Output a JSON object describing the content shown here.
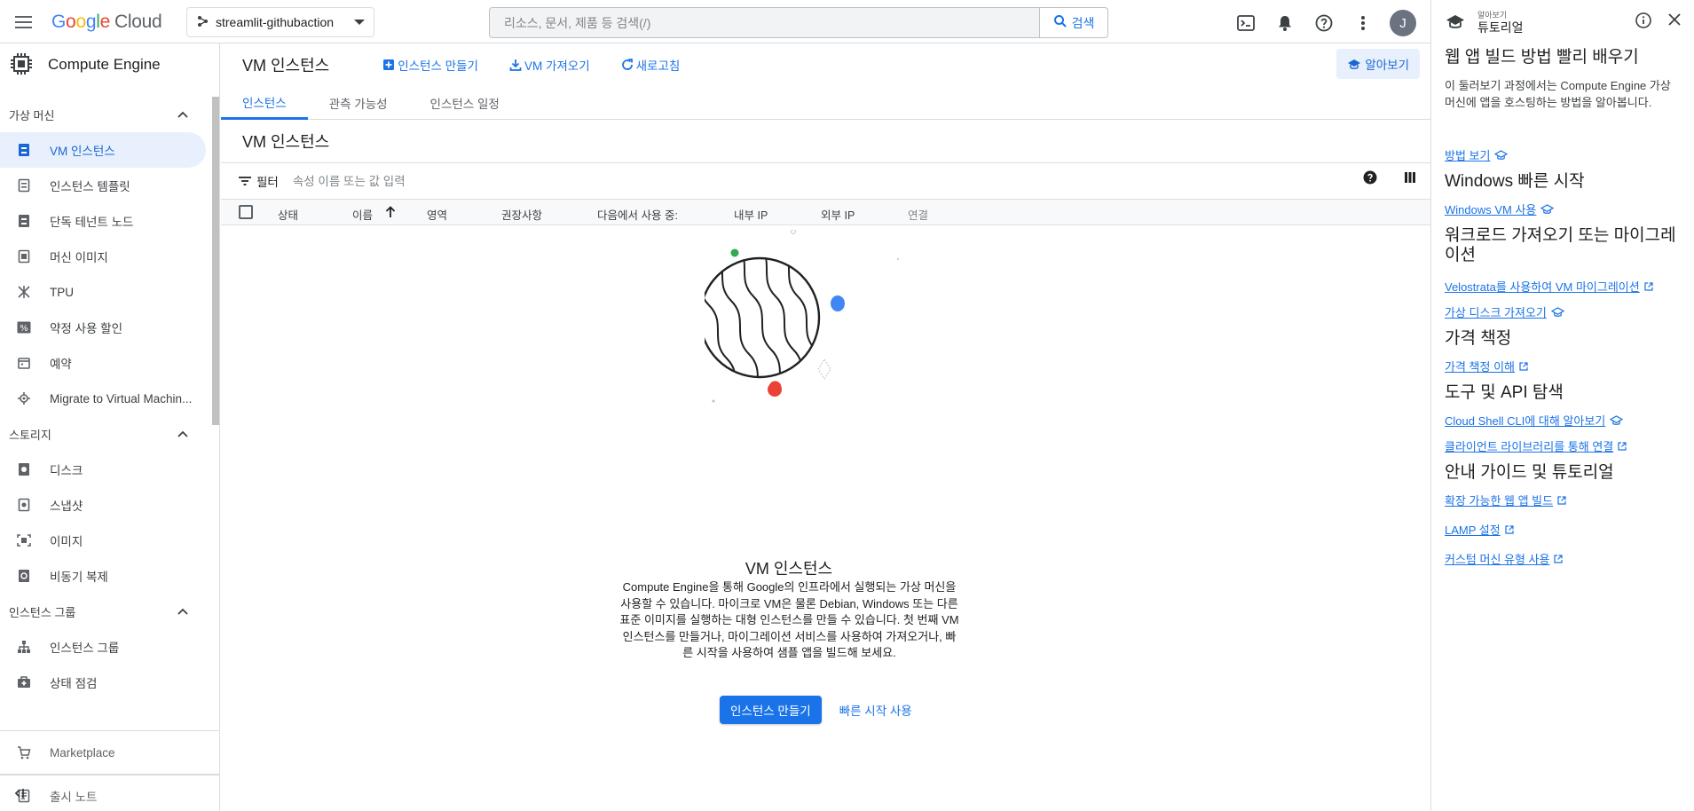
{
  "topbar": {
    "logo": {
      "g": "G",
      "o1": "o",
      "o2": "o",
      "g2": "g",
      "l": "l",
      "e": "e",
      "cloud": "Cloud"
    },
    "project": "streamlit-githubaction",
    "search_placeholder": "리소스, 문서, 제품 등 검색(/)",
    "search_button": "검색",
    "avatar_initial": "J"
  },
  "sidebar": {
    "product": "Compute Engine",
    "sections": [
      {
        "label": "가상 머신",
        "items": [
          "VM 인스턴스",
          "인스턴스 템플릿",
          "단독 테넌트 노드",
          "머신 이미지",
          "TPU",
          "약정 사용 할인",
          "예약",
          "Migrate to Virtual Machin..."
        ]
      },
      {
        "label": "스토리지",
        "items": [
          "디스크",
          "스냅샷",
          "이미지",
          "비동기 복제"
        ]
      },
      {
        "label": "인스턴스 그룹",
        "items": [
          "인스턴스 그룹",
          "상태 점검"
        ]
      }
    ],
    "marketplace": "Marketplace",
    "release_notes": "출시 노트"
  },
  "main": {
    "title": "VM 인스턴스",
    "actions": {
      "create": "인스턴스 만들기",
      "import": "VM 가져오기",
      "refresh": "새로고침"
    },
    "learn": "알아보기",
    "tabs": [
      "인스턴스",
      "관측 가능성",
      "인스턴스 일정"
    ],
    "section_title": "VM 인스턴스",
    "filter_label": "필터",
    "filter_placeholder": "속성 이름 또는 값 입력",
    "columns": [
      "상태",
      "이름",
      "영역",
      "권장사항",
      "다음에서 사용 중:",
      "내부 IP",
      "외부 IP",
      "연결"
    ],
    "empty": {
      "title": "VM 인스턴스",
      "description": "Compute Engine을 통해 Google의 인프라에서 실행되는 가상 머신을 사용할 수 있습니다. 마이크로 VM은 물론 Debian, Windows 또는 다른 표준 이미지를 실행하는 대형 인스턴스를 만들 수 있습니다. 첫 번째 VM 인스턴스를 만들거나, 마이그레이션 서비스를 사용하여 가져오거나, 빠른 시작을 사용하여 샘플 앱을 빌드해 보세요.",
      "primary": "인스턴스 만들기",
      "secondary": "빠른 시작 사용"
    }
  },
  "rpanel": {
    "sup": "알아보기",
    "title": "튜토리얼",
    "h1": "웹 앱 빌드 방법 빨리 배우기",
    "intro": "이 둘러보기 과정에서는 Compute Engine 가상 머신에 앱을 호스팅하는 방법을 알아봅니다.",
    "link_show": "방법 보기",
    "h_windows": "Windows 빠른 시작",
    "link_windows": "Windows VM 사용",
    "h_workload": "워크로드 가져오기 또는 마이그레이션",
    "link_velostrata": "Velostrata를 사용하여 VM 마이그레이션",
    "link_disk": "가상 디스크 가져오기",
    "h_pricing": "가격 책정",
    "link_pricing": "가격 책정 이해",
    "h_tools": "도구 및 API 탐색",
    "link_shell": "Cloud Shell CLI에 대해 알아보기",
    "link_client": "클라이언트 라이브러리를 통해 연결",
    "h_guides": "안내 가이드 및 튜토리얼",
    "link_scalable": "확장 가능한 웹 앱 빌드",
    "link_lamp": "LAMP 설정",
    "link_custom": "커스텀 머신 유형 사용"
  },
  "colors": {
    "accent": "#1a73e8",
    "active_bg": "#e8f0fe",
    "yellow": "#fbbc04",
    "blue": "#4285f4",
    "red": "#ea4335",
    "green": "#34a853"
  }
}
